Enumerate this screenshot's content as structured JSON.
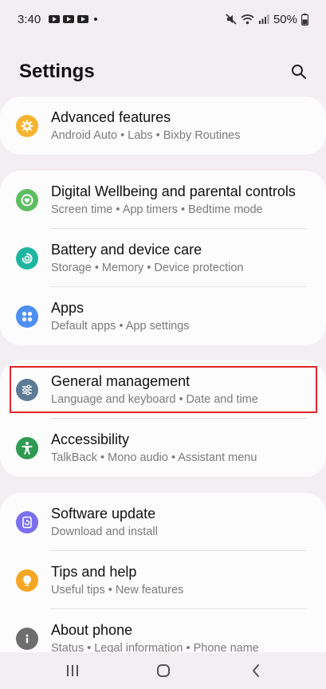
{
  "status_bar": {
    "time": "3:40",
    "battery": "50%"
  },
  "header": {
    "title": "Settings"
  },
  "groups": [
    {
      "items": [
        {
          "title": "Advanced features",
          "subtitle": "Android Auto  •  Labs  •  Bixby Routines",
          "icon": "gear-plus-icon",
          "color": "#f5b532"
        }
      ]
    },
    {
      "items": [
        {
          "title": "Digital Wellbeing and parental controls",
          "subtitle": "Screen time  •  App timers  •  Bedtime mode",
          "icon": "wellbeing-icon",
          "color": "#5dbe61"
        },
        {
          "title": "Battery and device care",
          "subtitle": "Storage  •  Memory  •  Device protection",
          "icon": "device-care-icon",
          "color": "#1eb6a2"
        },
        {
          "title": "Apps",
          "subtitle": "Default apps  •  App settings",
          "icon": "apps-icon",
          "color": "#4f8ff2"
        }
      ]
    },
    {
      "items": [
        {
          "title": "General management",
          "subtitle": "Language and keyboard  •  Date and time",
          "icon": "sliders-icon",
          "color": "#5d7b96"
        },
        {
          "title": "Accessibility",
          "subtitle": "TalkBack  •  Mono audio  •  Assistant menu",
          "icon": "accessibility-icon",
          "color": "#2e9a53"
        }
      ]
    },
    {
      "items": [
        {
          "title": "Software update",
          "subtitle": "Download and install",
          "icon": "software-update-icon",
          "color": "#7b6ff0"
        },
        {
          "title": "Tips and help",
          "subtitle": "Useful tips  •  New features",
          "icon": "lightbulb-icon",
          "color": "#f5a623"
        },
        {
          "title": "About phone",
          "subtitle": "Status  •  Legal information  •  Phone name",
          "icon": "info-icon",
          "color": "#6e6e6e"
        }
      ]
    }
  ]
}
